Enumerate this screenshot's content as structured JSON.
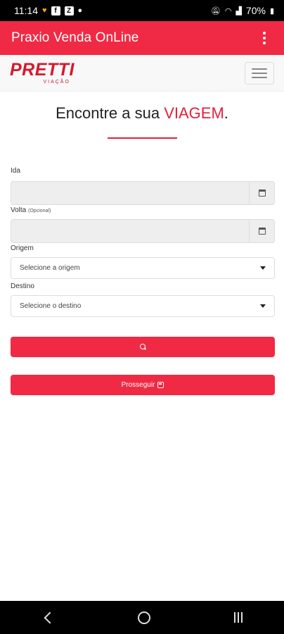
{
  "status_bar": {
    "time": "11:14",
    "battery": "70%",
    "left_icons": [
      "heart-icon",
      "f-icon",
      "z-icon",
      "dot-icon"
    ],
    "right_icons": [
      "mute-icon",
      "wifi-icon",
      "signal-icon",
      "battery-icon"
    ]
  },
  "app_bar": {
    "title": "Praxio Venda OnLine",
    "menu_icon": "more-vert-icon"
  },
  "brand": {
    "logo_main": "PRETTI",
    "logo_sub": "VIAÇÃO",
    "menu_icon": "hamburger-icon"
  },
  "headline": {
    "prefix": "Encontre a sua ",
    "accent": "VIAGEM",
    "suffix": "."
  },
  "form": {
    "ida_label": "Ida",
    "ida_value": "",
    "volta_label": "Volta",
    "volta_hint": "(Opcional)",
    "volta_value": "",
    "origem_label": "Origem",
    "origem_placeholder": "Selecione a origem",
    "destino_label": "Destino",
    "destino_placeholder": "Selecione o destino",
    "prosseguir_label": "Prosseguir"
  },
  "colors": {
    "primary": "#f02a44",
    "accent_text": "#e5203a",
    "logo": "#d5182c"
  }
}
